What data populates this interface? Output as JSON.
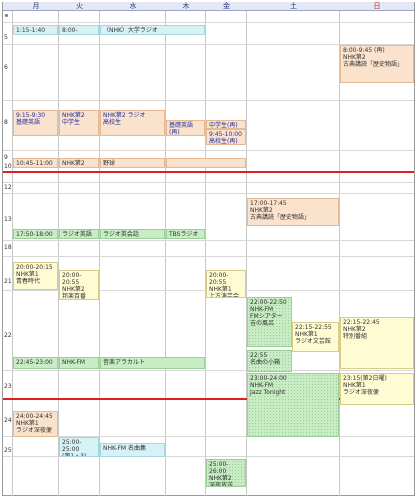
{
  "days": [
    {
      "label": "月"
    },
    {
      "label": "火"
    },
    {
      "label": "水"
    },
    {
      "label": "木"
    },
    {
      "label": "金"
    },
    {
      "label": "土"
    },
    {
      "label": "日"
    }
  ],
  "hours": [
    "5",
    "6",
    "8",
    "9",
    "10",
    "12",
    "13",
    "18",
    "21",
    "22",
    "23",
    "24",
    "25"
  ],
  "events": [
    {
      "text": "1:15-1:40",
      "color": "lightblue"
    },
    {
      "text": "8:00-",
      "color": "lightblue"
    },
    {
      "text": "（NHK）大学ラジオ",
      "color": "lightblue"
    },
    {
      "text": "8:00-9:45 (再)\nNHK第2\n古典講読「歴史物語」",
      "color": "peach"
    },
    {
      "text": "9:15-9:30\n基礎英語",
      "color": "peach"
    },
    {
      "text": "NHK第2\n中学生",
      "color": "peach"
    },
    {
      "text": "NHK第2 ラジオ\n高校生",
      "color": "peach"
    },
    {
      "text": "基礎英語(再)",
      "color": "peach"
    },
    {
      "text": "中学生(再)",
      "color": "peach"
    },
    {
      "text": "9:45-10:00\n高校生(再)",
      "color": "peach"
    },
    {
      "text": "10:45-11:00",
      "color": "peach"
    },
    {
      "text": "NHK第2",
      "color": "peach"
    },
    {
      "text": "野球",
      "color": "peach"
    },
    {
      "text": "17:00-17:45\nNHK第2\n古典講読「歴史物語」",
      "color": "peach"
    },
    {
      "text": "17:50-18:00",
      "color": "green"
    },
    {
      "text": "ラジオ英語",
      "color": "green"
    },
    {
      "text": "ラジオ英会話",
      "color": "green"
    },
    {
      "text": "TBSラジオ",
      "color": "green"
    },
    {
      "text": "20:00-20:15\nNHK第1\n青春時代",
      "color": "yellow"
    },
    {
      "text": "20:00-20:55\nNHK第2\n邦楽百番",
      "color": "yellow"
    },
    {
      "text": "20:00-20:55\nNHK第1\n上方演芸会",
      "color": "yellow"
    },
    {
      "text": "22:00-22:50\nNHK-FM\nFMシアター\n吉の風呂",
      "color": "dotgreen"
    },
    {
      "text": "22:15-22:55\nNHK第1\nラジオ文芸館",
      "color": "yellow"
    },
    {
      "text": "22:15-22:45\nNHK第2\n特別番組",
      "color": "yellow"
    },
    {
      "text": "22:55\n名曲の小箱",
      "color": "dotgreen"
    },
    {
      "text": "22:45-23:00",
      "color": "green"
    },
    {
      "text": "NHK-FM",
      "color": "green"
    },
    {
      "text": "音楽アラカルト",
      "color": "green"
    },
    {
      "text": "23:00-24:00\nNHK-FM\nJazz Tonight",
      "color": "dotgreen"
    },
    {
      "text": "23:15(第2日曜)\nNHK第1\nラジオ深夜便",
      "color": "yellow"
    },
    {
      "text": "24:00-24:45\nNHK第1\nラジオ深夜便",
      "color": "peach"
    },
    {
      "text": "25:00-25:00\n(第1・3)",
      "color": "lightblue"
    },
    {
      "text": "NHK-FM 名曲集",
      "color": "lightblue"
    },
    {
      "text": "25:00-26:00\nNHK第2\n深夜放送",
      "color": "dotgreen"
    }
  ]
}
